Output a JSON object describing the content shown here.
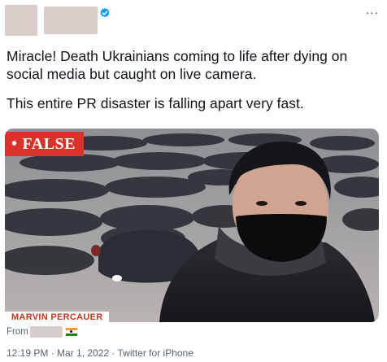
{
  "header": {
    "more_icon": "more-icon",
    "verified_icon": "verified-badge-icon",
    "more_glyph": "..."
  },
  "tweet": {
    "line1": "Miracle! Death Ukrainians coming to life after dying on social media but caught on live camera.",
    "line2": "This entire PR disaster is falling apart very fast."
  },
  "media": {
    "badge_dot": "•",
    "badge_label": "FALSE",
    "lower_third": "MARVIN PERCAUER"
  },
  "footer": {
    "from_label": "From",
    "flag_icon": "india-flag-icon",
    "timestamp": "12:19 PM · Mar 1, 2022 · Twitter for iPhone"
  },
  "colors": {
    "badge_red": "#d8322a",
    "verified_blue": "#1d9bf0",
    "meta_gray": "#536471"
  }
}
